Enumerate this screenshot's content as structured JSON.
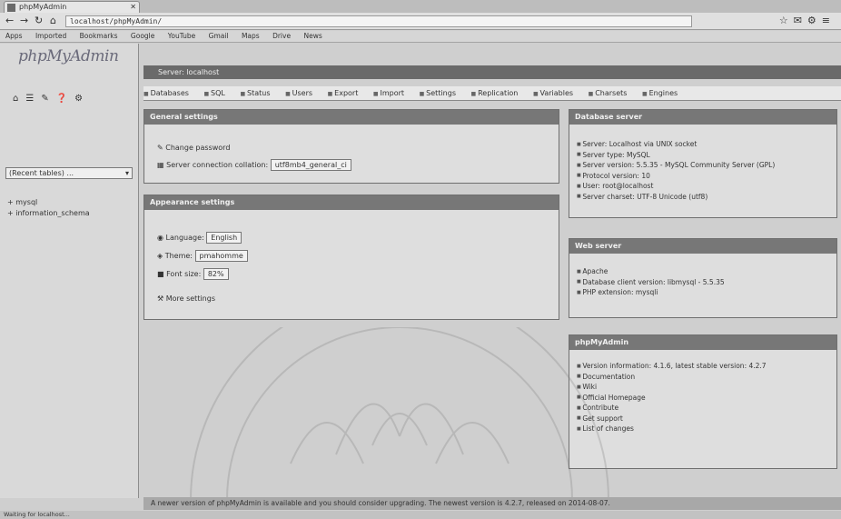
{
  "browser": {
    "tab_title": "phpMyAdmin",
    "url": "localhost/phpMyAdmin/",
    "bookmarks": [
      "Apps",
      "Imported",
      "Bookmarks",
      "Google",
      "YouTube",
      "Gmail",
      "Maps",
      "Drive",
      "News"
    ]
  },
  "sidebar": {
    "logo_main": "phpMyAdmin",
    "db_select_value": "(Recent tables) ...",
    "databases": [
      "mysql",
      "information_schema"
    ]
  },
  "server_bar": "Server: localhost",
  "menu": [
    "Databases",
    "SQL",
    "Status",
    "Users",
    "Export",
    "Import",
    "Settings",
    "Replication",
    "Variables",
    "Charsets",
    "Engines"
  ],
  "general_settings": {
    "title": "General settings",
    "change_password": "Change password",
    "collation_label": "Server connection collation:",
    "collation_value": "utf8mb4_general_ci"
  },
  "appearance": {
    "title": "Appearance settings",
    "language_label": "Language:",
    "language_value": "English",
    "theme_label": "Theme:",
    "theme_value": "pmahomme",
    "font_label": "Font size:",
    "font_value": "82%",
    "more_settings": "More settings"
  },
  "db_server": {
    "title": "Database server",
    "items": [
      "Server: Localhost via UNIX socket",
      "Server type: MySQL",
      "Server version: 5.5.35 - MySQL Community Server (GPL)",
      "Protocol version: 10",
      "User: root@localhost",
      "Server charset: UTF-8 Unicode (utf8)"
    ]
  },
  "web_server": {
    "title": "Web server",
    "items": [
      "Apache",
      "Database client version: libmysql - 5.5.35",
      "PHP extension: mysqli"
    ]
  },
  "phpmyadmin": {
    "title": "phpMyAdmin",
    "items": [
      "Version information: 4.1.6, latest stable version: 4.2.7",
      "Documentation",
      "Wiki",
      "Official Homepage",
      "Contribute",
      "Get support",
      "List of changes"
    ]
  },
  "footer": "A newer version of phpMyAdmin is available and you should consider upgrading. The newest version is 4.2.7, released on 2014-08-07.",
  "statusbar": "Waiting for localhost..."
}
